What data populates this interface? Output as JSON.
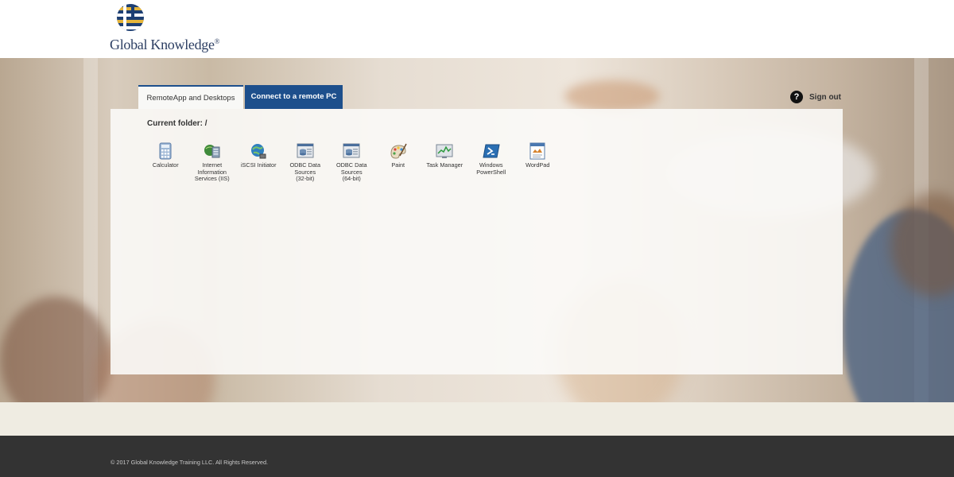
{
  "header": {
    "brand_name": "Global Knowledge",
    "brand_mark": "®"
  },
  "tabs": [
    {
      "label": "RemoteApp and Desktops",
      "active": true
    },
    {
      "label": "Connect to a remote PC",
      "active": false
    }
  ],
  "sign_out": {
    "label": "Sign out",
    "icon": "help-icon",
    "icon_glyph": "?"
  },
  "main": {
    "current_folder": "Current folder: /",
    "apps": [
      {
        "label": "Calculator",
        "icon": "calculator-icon"
      },
      {
        "label": "Internet\nInformation\nServices (IIS)",
        "icon": "iis-icon"
      },
      {
        "label": "iSCSI Initiator",
        "icon": "iscsi-initiator-icon"
      },
      {
        "label": "ODBC Data\nSources\n(32-bit)",
        "icon": "odbc-32-icon"
      },
      {
        "label": "ODBC Data\nSources\n(64-bit)",
        "icon": "odbc-64-icon"
      },
      {
        "label": "Paint",
        "icon": "paint-icon"
      },
      {
        "label": "Task Manager",
        "icon": "task-manager-icon"
      },
      {
        "label": "Windows\nPowerShell",
        "icon": "powershell-icon"
      },
      {
        "label": "WordPad",
        "icon": "wordpad-icon"
      }
    ]
  },
  "footer": {
    "copyright": "© 2017 Global Knowledge Training LLC. All Rights Reserved."
  },
  "colors": {
    "accent": "#1d4f8c",
    "footer_bg": "#333333",
    "band_bg": "#efece2"
  }
}
